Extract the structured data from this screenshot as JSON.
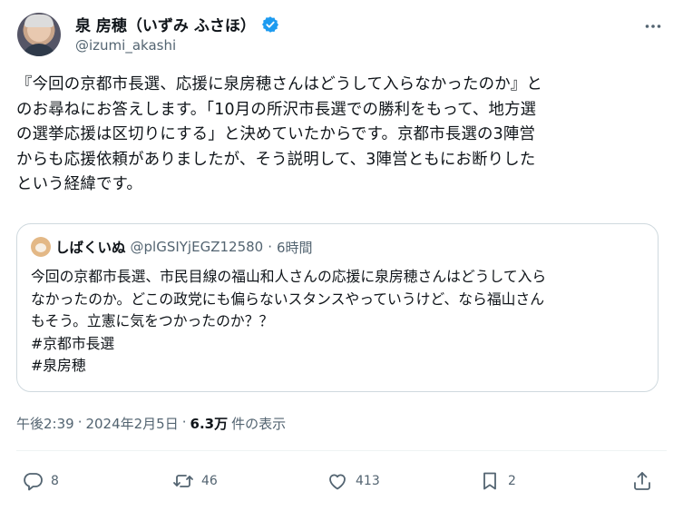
{
  "author": {
    "display_name": "泉 房穂（いずみ ふさほ）",
    "handle": "@izumi_akashi",
    "verified_color": "#1d9bf0"
  },
  "tweet": {
    "lines": [
      "『今回の京都市長選、応援に泉房穂さんはどうして入らなかったのか』と",
      "のお尋ねにお答えします。「10月の所沢市長選での勝利をもって、地方選",
      "の選挙応援は区切りにする」と決めていたからです。京都市長選の3陣営",
      "からも応援依頼がありましたが、そう説明して、3陣営ともにお断りした",
      "という経緯です。"
    ]
  },
  "quote": {
    "name": "しばくいぬ",
    "handle": "@plGSIYjEGZ12580",
    "separator": "·",
    "time": "6時間",
    "lines": [
      "今回の京都市長選、市民目線の福山和人さんの応援に泉房穂さんはどうして入ら",
      "なかったのか。どこの政党にも偏らないスタンスやっていうけど、なら福山さん",
      "もそう。立憲に気をつかったのか？？"
    ],
    "hashtags": [
      "#京都市長選",
      "#泉房穂"
    ]
  },
  "meta": {
    "time": "午後2:39",
    "dot1": "·",
    "date": "2024年2月5日",
    "dot2": "·",
    "views": "6.3万",
    "views_label": "件の表示"
  },
  "actions": {
    "replies": "8",
    "retweets": "46",
    "likes": "413",
    "bookmarks": "2"
  },
  "icons": [
    "verified-badge-icon",
    "more-icon",
    "reply-icon",
    "retweet-icon",
    "like-icon",
    "bookmark-icon",
    "share-icon"
  ]
}
